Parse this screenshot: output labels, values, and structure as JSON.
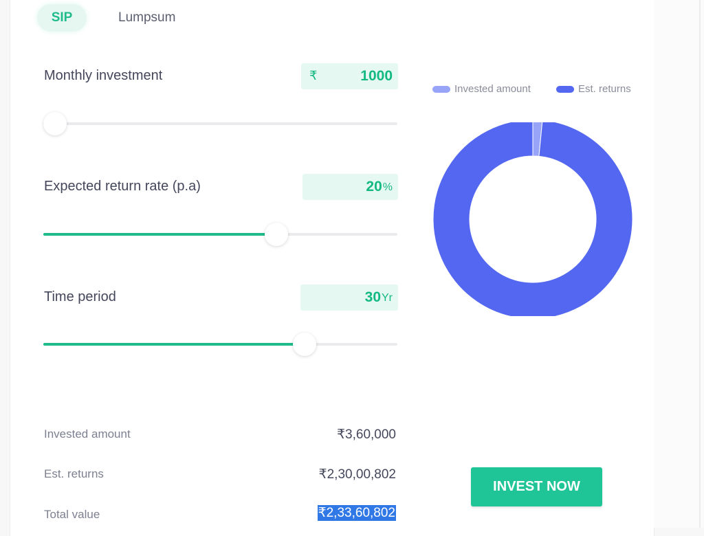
{
  "tabs": {
    "sip": "SIP",
    "lumpsum": "Lumpsum"
  },
  "inputs": {
    "monthly_investment": {
      "label": "Monthly investment",
      "prefix": "₹",
      "value": "1000"
    },
    "return_rate": {
      "label": "Expected return rate (p.a)",
      "value": "20",
      "suffix": "%"
    },
    "time_period": {
      "label": "Time period",
      "value": "30",
      "suffix": "Yr"
    }
  },
  "sliders": {
    "monthly_investment_fraction": 0.0,
    "return_rate_fraction": 0.65,
    "time_period_fraction": 0.73
  },
  "summary": {
    "invested_amount": {
      "label": "Invested amount",
      "value": "₹3,60,000"
    },
    "est_returns": {
      "label": "Est. returns",
      "value": "₹2,30,00,802"
    },
    "total_value": {
      "label": "Total value",
      "value": "₹2,33,60,802"
    }
  },
  "legend": {
    "invested": {
      "label": "Invested amount",
      "color": "#98a4f8"
    },
    "returns": {
      "label": "Est. returns",
      "color": "#5367f0"
    }
  },
  "chart_data": {
    "type": "pie",
    "labels": [
      "Invested amount",
      "Est. returns"
    ],
    "values": [
      360000,
      23000802
    ],
    "colors": [
      "#98a4f8",
      "#5367f0"
    ]
  },
  "colors": {
    "accent": "#1fbb8a",
    "button": "#1fc596",
    "highlight": "#2f78e6"
  },
  "actions": {
    "invest_now": "INVEST NOW"
  }
}
